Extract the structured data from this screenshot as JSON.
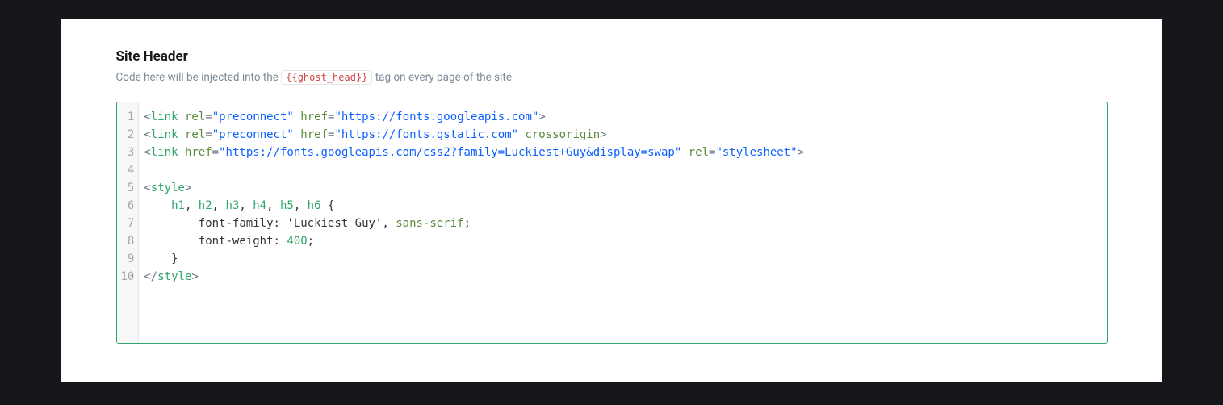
{
  "header": {
    "title": "Site Header",
    "desc_before": "Code here will be injected into the ",
    "desc_tag": "{{ghost_head}}",
    "desc_after": " tag on every page of the site"
  },
  "editor": {
    "line_numbers": [
      "1",
      "2",
      "3",
      "4",
      "5",
      "6",
      "7",
      "8",
      "9",
      "10"
    ],
    "lines": [
      [
        {
          "t": "<",
          "c": "tok-punct"
        },
        {
          "t": "link",
          "c": "tok-tag"
        },
        {
          "t": " "
        },
        {
          "t": "rel",
          "c": "tok-attr"
        },
        {
          "t": "=",
          "c": "tok-punct"
        },
        {
          "t": "\"preconnect\"",
          "c": "tok-str"
        },
        {
          "t": " "
        },
        {
          "t": "href",
          "c": "tok-attr"
        },
        {
          "t": "=",
          "c": "tok-punct"
        },
        {
          "t": "\"https://fonts.googleapis.com\"",
          "c": "tok-str"
        },
        {
          "t": ">",
          "c": "tok-punct"
        }
      ],
      [
        {
          "t": "<",
          "c": "tok-punct"
        },
        {
          "t": "link",
          "c": "tok-tag"
        },
        {
          "t": " "
        },
        {
          "t": "rel",
          "c": "tok-attr"
        },
        {
          "t": "=",
          "c": "tok-punct"
        },
        {
          "t": "\"preconnect\"",
          "c": "tok-str"
        },
        {
          "t": " "
        },
        {
          "t": "href",
          "c": "tok-attr"
        },
        {
          "t": "=",
          "c": "tok-punct"
        },
        {
          "t": "\"https://fonts.gstatic.com\"",
          "c": "tok-str"
        },
        {
          "t": " "
        },
        {
          "t": "crossorigin",
          "c": "tok-attr"
        },
        {
          "t": ">",
          "c": "tok-punct"
        }
      ],
      [
        {
          "t": "<",
          "c": "tok-punct"
        },
        {
          "t": "link",
          "c": "tok-tag"
        },
        {
          "t": " "
        },
        {
          "t": "href",
          "c": "tok-attr"
        },
        {
          "t": "=",
          "c": "tok-punct"
        },
        {
          "t": "\"https://fonts.googleapis.com/css2?family=Luckiest+Guy&display=swap\"",
          "c": "tok-str"
        },
        {
          "t": " "
        },
        {
          "t": "rel",
          "c": "tok-attr"
        },
        {
          "t": "=",
          "c": "tok-punct"
        },
        {
          "t": "\"stylesheet\"",
          "c": "tok-str"
        },
        {
          "t": ">",
          "c": "tok-punct"
        }
      ],
      [],
      [
        {
          "t": "<",
          "c": "tok-punct"
        },
        {
          "t": "style",
          "c": "tok-tag"
        },
        {
          "t": ">",
          "c": "tok-punct"
        }
      ],
      [
        {
          "t": "    "
        },
        {
          "t": "h1",
          "c": "tok-tag"
        },
        {
          "t": ", "
        },
        {
          "t": "h2",
          "c": "tok-tag"
        },
        {
          "t": ", "
        },
        {
          "t": "h3",
          "c": "tok-tag"
        },
        {
          "t": ", "
        },
        {
          "t": "h4",
          "c": "tok-tag"
        },
        {
          "t": ", "
        },
        {
          "t": "h5",
          "c": "tok-tag"
        },
        {
          "t": ", "
        },
        {
          "t": "h6",
          "c": "tok-tag"
        },
        {
          "t": " {"
        }
      ],
      [
        {
          "t": "        font-family: 'Luckiest Guy', "
        },
        {
          "t": "sans-serif",
          "c": "tok-kw"
        },
        {
          "t": ";"
        }
      ],
      [
        {
          "t": "        font-weight: "
        },
        {
          "t": "400",
          "c": "tok-num"
        },
        {
          "t": ";"
        }
      ],
      [
        {
          "t": "    }"
        }
      ],
      [
        {
          "t": "</",
          "c": "tok-punct"
        },
        {
          "t": "style",
          "c": "tok-tag"
        },
        {
          "t": ">",
          "c": "tok-punct"
        }
      ]
    ]
  }
}
